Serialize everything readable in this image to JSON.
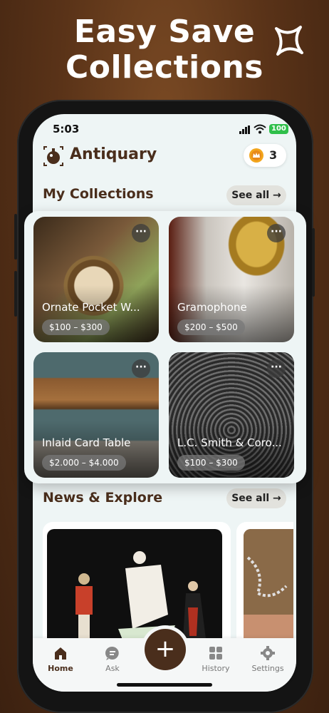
{
  "promo": {
    "line1": "Easy Save",
    "line2": "Collections"
  },
  "status": {
    "time": "5:03",
    "battery": "100"
  },
  "app": {
    "title": "Antiquary",
    "coins": "3"
  },
  "collections": {
    "title": "My Collections",
    "see_all": "See all →",
    "items": [
      {
        "name": "Ornate Pocket W...",
        "price": "$100 – $300"
      },
      {
        "name": "Gramophone",
        "price": "$200 – $500"
      },
      {
        "name": "Inlaid Card Table",
        "price": "$2.000 – $4.000"
      },
      {
        "name": "L.C. Smith & Coro...",
        "price": "$100 – $300"
      }
    ],
    "more_label": "···"
  },
  "news": {
    "title": "News & Explore",
    "see_all": "See all →"
  },
  "tabs": [
    {
      "label": "Home",
      "icon": "home-icon"
    },
    {
      "label": "Ask",
      "icon": "chat-icon"
    },
    {
      "label": "History",
      "icon": "grid-icon"
    },
    {
      "label": "Settings",
      "icon": "gear-icon"
    }
  ],
  "fab": "+",
  "colors": {
    "brand": "#4a2e1c",
    "background": "#5a3318",
    "screen": "#eef5f5"
  }
}
